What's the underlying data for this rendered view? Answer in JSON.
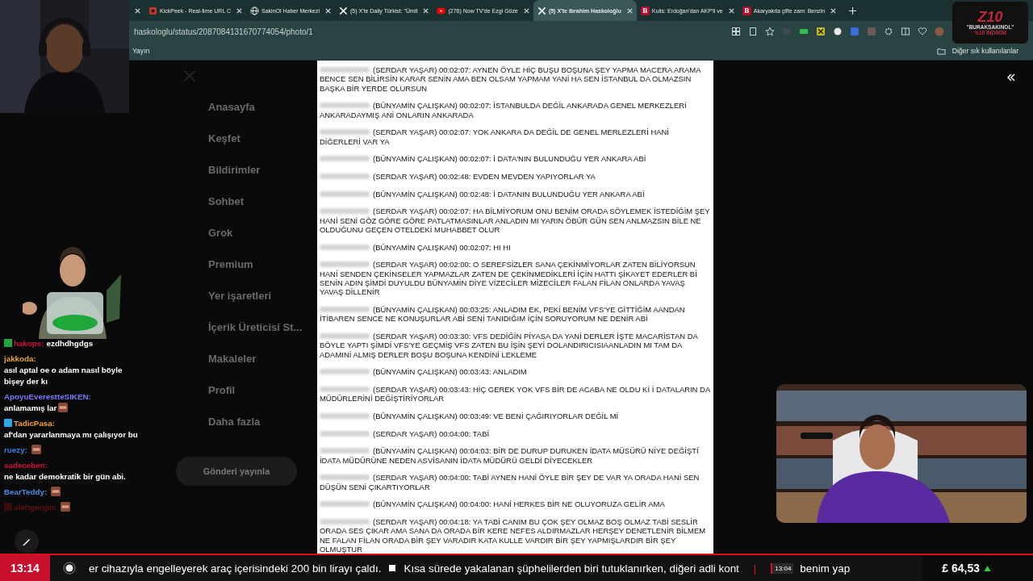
{
  "browser": {
    "tabs": [
      {
        "kind": "cut"
      },
      {
        "kind": "kick",
        "title": "KickPeek - Real-time URL C",
        "selected": false
      },
      {
        "kind": "globe",
        "title": "SakinOl Haber Merkezi",
        "selected": false
      },
      {
        "kind": "x",
        "title": "(5) X'te Daily Türkist: \"Ümit",
        "selected": false
      },
      {
        "kind": "youtube",
        "title": "(276) Now TV'de Ezgi Göze",
        "selected": false
      },
      {
        "kind": "x",
        "title": "(5) X'te ibrahim Haskoloğlu",
        "selected": true
      },
      {
        "kind": "letter",
        "favicon_text": "B",
        "title": "Kulis: Erdoğan'dan AKP'li ve",
        "selected": false
      },
      {
        "kind": "letter",
        "favicon_text": "B",
        "title": "Akaryakıta çifte zam: Benzin",
        "selected": false
      }
    ],
    "address": "haskologlu/status/2087084131670774054/photo/1",
    "bookmarks": [
      "Yayın"
    ],
    "other_bookmarks": "Diğer sık kullanılanlar"
  },
  "x_sidebar": {
    "items": [
      "Anasayfa",
      "Keşfet",
      "Bildirimler",
      "Sohbet",
      "Grok",
      "Premium",
      "Yer işaretleri",
      "İçerik Üreticisi St...",
      "Makaleler",
      "Profil",
      "Daha fazla"
    ],
    "post_button": "Gönderi yayınla"
  },
  "document": {
    "lines": [
      {
        "text": "(SERDAR YAŞAR) 00:02:07:  AYNEN ÖYLE HİÇ BUŞU BOŞUNA ŞEY YAPMA MACERA ARAMA BENCE SEN BİLİRSİN KARAR SENİN AMA BEN OLSAM YAPMAM YANİ HA SEN İSTANBUL DA OLMAZSIN BAŞKA BİR YERDE OLURSUN"
      },
      {
        "text": "(BÜNYAMİN ÇALIŞKAN) 00:02:07:  İSTANBULDA DEĞİL ANKARADA GENEL MERKEZLERİ ANKARADAYMIŞ ANİ ONLARIN ANKARADA"
      },
      {
        "text": "(SERDAR YAŞAR) 00:02:07:  YOK ANKARA DA DEĞİL DE GENEL MERLEZLERİ HANİ DİĞERLERİ VAR YA"
      },
      {
        "text": "(BÜNYAMİN ÇALIŞKAN) 00:02:07:   İ DATA'NIN BULUNDUĞU YER ANKARA ABİ"
      },
      {
        "text": "(SERDAR YAŞAR) 00:02:48:   EVDEN MEVDEN YAPIYORLAR YA"
      },
      {
        "text": "(BÜNYAMİN ÇALIŞKAN) 00:02:48:  İ DATANIN BULUNDUĞU YER ANKARA ABİ"
      },
      {
        "text": "(SERDAR YAŞAR) 00:02:07: HA BİLMİYORUM ONU BENİM ORADA SÖYLEMEK İSTEDİĞİM ŞEY HANİ SENİ GÖZ GÖRE GÖRE PATLATMASINLAR ANLADIN MI YARIN ÖBÜR GÜN SEN ANLMAZSIN BİLE NE OLDUĞUNU GEÇEN OTELDEKİ MUHABBET OLUR"
      },
      {
        "text": "(BÜNYAMİN ÇALIŞKAN) 00:02:07:  HI HI"
      },
      {
        "text": "(SERDAR YAŞAR) 00:02:00:  O SEREFSİZLER SANA ÇEKİNMİYORLAR ZATEN BİLİYORSUN HANİ SENDEN ÇEKİNSELER YAPMAZLAR ZATEN DE ÇEKİNMEDİKLERİ İÇİN HATTI ŞİKAYET EDERLER Bİ SENİN ADIN ŞİMDİ DUYULDU BÜNYAMİN DİYE VİZECİLER MİZECİLER FALAN FİLAN ONLARDA YAVAŞ YAVAŞ DİLLENİR"
      },
      {
        "text": "(BÜNYAMİN ÇALIŞKAN) 00:03:25:  ANLADIM EK, PEKİ BENİM VFS'YE GİTTİĞİM AANDAN İTİBAREN SENCE NE KONUŞURLAR ABİ SENİ TANIDIĞIM İÇİN SORUYORUM NE DENİR ABİ"
      },
      {
        "text": "(SERDAR YAŞAR) 00:03:30:  VFS DEDİĞİN PİYASA DA YANİ DERLER İŞTE MACARİSTAN DA BÖYLE YAPTI ŞİMDİ VFS'YE GEÇMİŞ VFS ZATEN BU İŞİN ŞEYİ DOLANDIRICISIAANLADIN MI TAM DA ADAMINİ ALMIŞ DERLER BOŞU BOŞUNA KENDİNİ LEKLEME"
      },
      {
        "text": "(BÜNYAMİN ÇALIŞKAN) 00:03:43:  ANLADIM"
      },
      {
        "text": "(SERDAR YAŞAR) 00:03:43:  HİÇ GEREK YOK VFS BİR DE ACABA NE OLDU Kİ İ DATALARIN DA MÜDÜRLERİNİ DEĞİŞTİRİYORLAR"
      },
      {
        "text": "(BÜNYAMİN ÇALIŞKAN) 00:03:49:  VE BENİ ÇAĞIRIYORLAR DEĞİL Mİ"
      },
      {
        "text": "(SERDAR YAŞAR) 00:04:00:  TABİ"
      },
      {
        "text": "(BÜNYAMİN ÇALIŞKAN) 00:04:03:  BİR DE DURUP DURUKEN İDATA MÜSÜRÜ NİYE DEĞİŞTİ İDATA MÜDÜRÜNE NEDEN ASVİSANIN İDATA MÜDÜRÜ GELDİ DİYECEKLER"
      },
      {
        "text": "(SERDAR YAŞAR) 00:04:00:  TABİ AYNEN HANİ ÖYLE BİR ŞEY DE VAR YA ORADA HANİ SEN DÜŞÜN SENİ ÇIKARTIYORLAR"
      },
      {
        "text": "(BÜNYAMİN ÇALIŞKAN) 00:04:00:  HANİ HERKES BİR NE OLUYORUZA GELİR AMA"
      },
      {
        "text": "(SERDAR YAŞAR) 00:04:18:  YA TABİ CANIM  BU ÇOK ŞEY OLMAZ BOŞ OLMAZ TABİ SESLİR ORADA SES ÇIKAR AMA SANA DA ORADA BİR KERE NEFES ALDIRMAZLAR HERŞEY DENETLENİR BİLMEM NE FALAN FİLAN ORADA BİR ŞEY VARADIR KATA KULLE VARDIR BİR ŞEY YAPMIŞLARDIR BİR ŞEY OLMUŞTUR"
      }
    ]
  },
  "chat": [
    {
      "user": "hakops:",
      "color": "#d0103a",
      "badge": {
        "color": "#1fa83a"
      },
      "message": "ezdhdhgdgs",
      "emote": false
    },
    {
      "user": "jakkoda:",
      "color": "#e8a33a",
      "message": "asıl aptal oe o adam nasıl böyle bişey der kı",
      "emote": false
    },
    {
      "user": "ApoyuEverestteSIKEN:",
      "color": "#7a78ff",
      "message": "anlamamış lar",
      "emote": true
    },
    {
      "user": "TadicPasa:",
      "color": "#f0a030",
      "badge": {
        "color": "#2aa8e8"
      },
      "message": "af'dan yararlanmaya mı çalışıyor bu",
      "emote": false
    },
    {
      "user": "ruezy:",
      "color": "#3a7fe0",
      "emote": true
    },
    {
      "user": "sadeceben:",
      "color": "#d0103a",
      "message": "ne kadar demokratik bir gün abi.",
      "emote": false
    },
    {
      "user": "BearTeddy:",
      "color": "#4a8ae8",
      "emote": true
    },
    {
      "user": "alettgergin:",
      "color": "#5a1414",
      "badge": {
        "color": "#3a0d0d"
      },
      "emote": true
    }
  ],
  "sponsor": {
    "logo": "Z10",
    "code": "\"BURAKSAKINOL\"",
    "offer": "%10 İNDİRİM"
  },
  "ticker": {
    "clock": "13:14",
    "headline": "er cihazıyla engelleyerek araç içerisindeki 200 bin lirayı çaldı.",
    "headline2": "Kısa sürede yakalanan şüphelilerden biri tutuklanırken, diğeri adli kont",
    "separator": "|",
    "time": "13:04",
    "next": "benim yap",
    "price": "£ 64,53"
  }
}
